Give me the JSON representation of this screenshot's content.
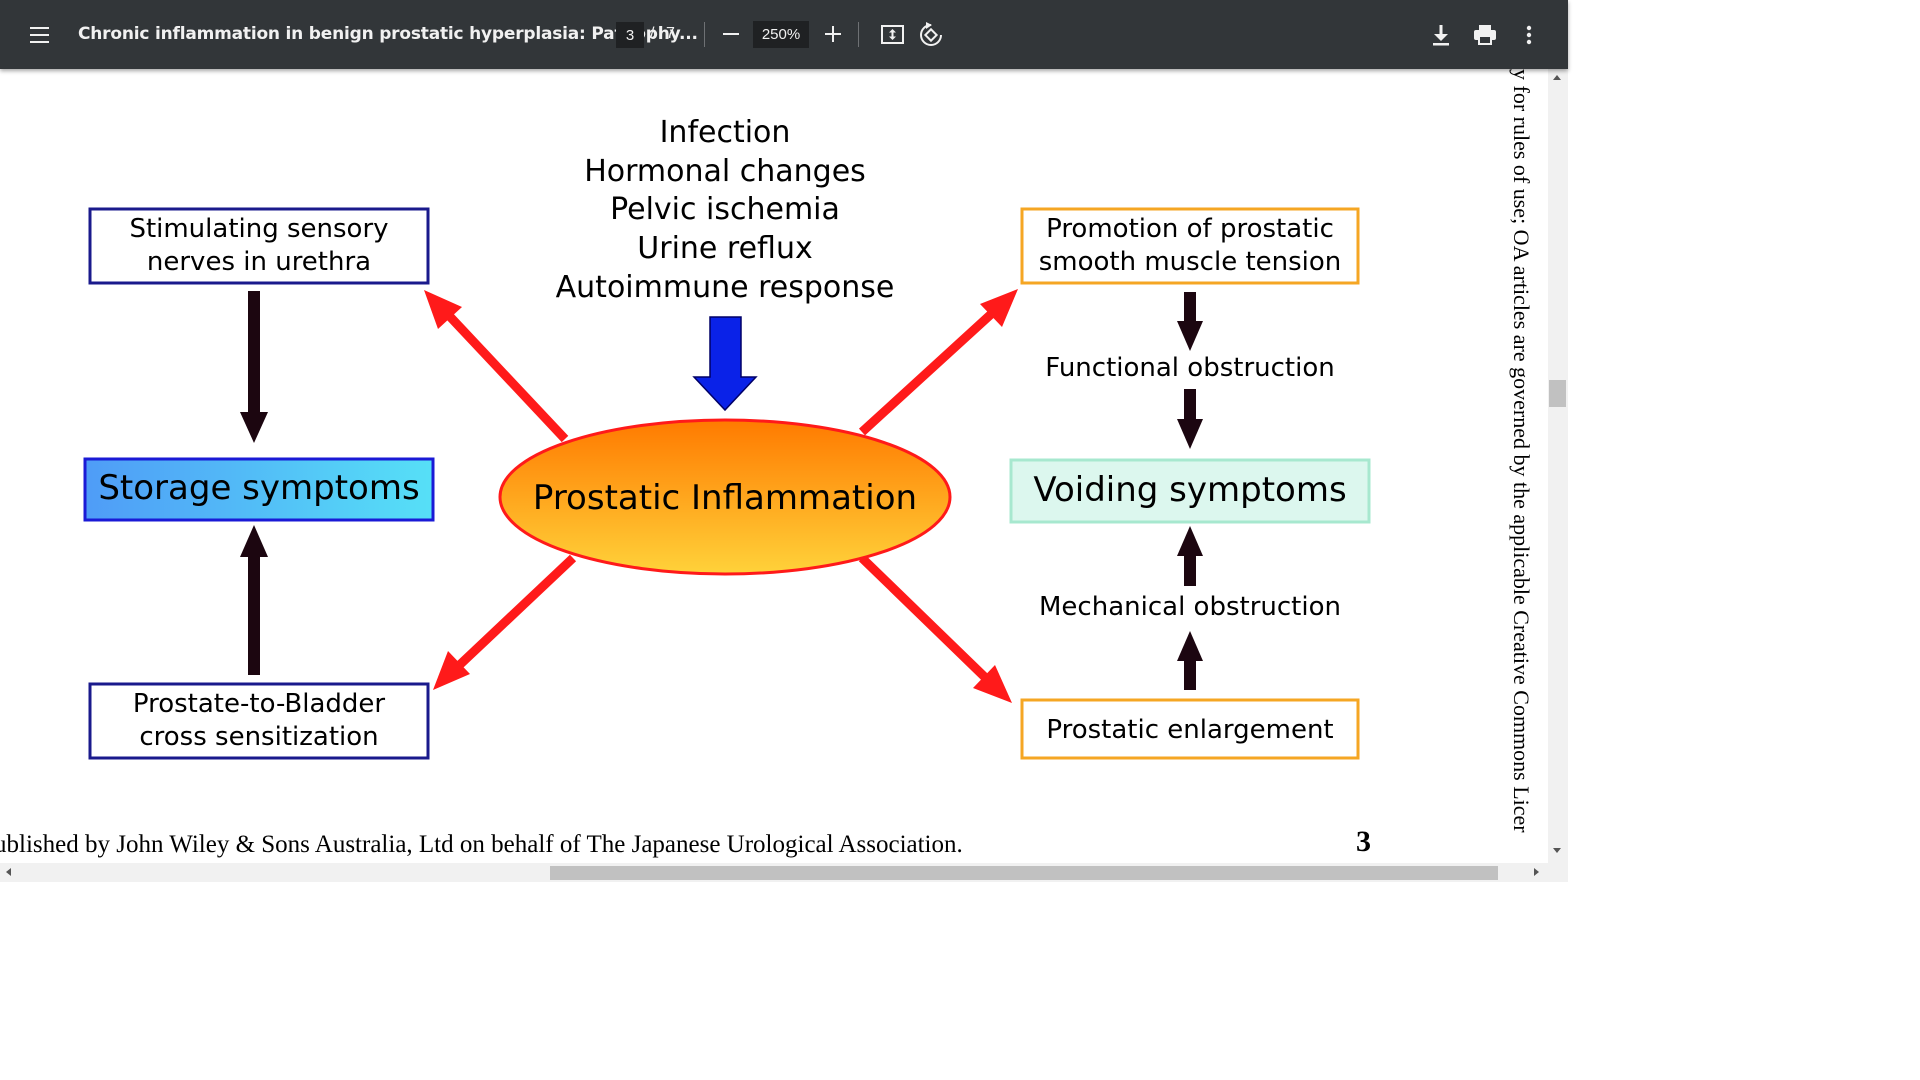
{
  "toolbar": {
    "title": "Chronic inflammation in benign prostatic hyperplasia: Pathophy...",
    "current_page": "3",
    "page_separator": "/",
    "total_pages": "7",
    "zoom": "250%"
  },
  "icons": {
    "menu": "menu-icon",
    "zoom_out": "minus-icon",
    "zoom_in": "plus-icon",
    "fit": "fit-to-page-icon",
    "rotate": "rotate-icon",
    "download": "download-icon",
    "print": "printer-icon",
    "more": "more-vertical-icon"
  },
  "colors": {
    "toolbar_bg": "#323639",
    "navy_box_border": "#1a1a8c",
    "orange_box_border": "#f5a623",
    "storage_fill": "#5fc9f5",
    "voiding_fill": "#dcf7ee",
    "red_arrow": "#ff1a1a",
    "blue_arrow": "#0a22e8"
  },
  "figure": {
    "causes": [
      "Infection",
      "Hormonal changes",
      "Pelvic ischemia",
      "Urine reflux",
      "Autoimmune response"
    ],
    "center": "Prostatic Inflammation",
    "left_top": [
      "Stimulating sensory",
      "nerves in urethra"
    ],
    "left_middle": "Storage symptoms",
    "left_bottom": [
      "Prostate-to-Bladder",
      "cross sensitization"
    ],
    "right_top": [
      "Promotion of prostatic",
      "smooth muscle tension"
    ],
    "right_label_top": "Functional obstruction",
    "right_middle": "Voiding symptoms",
    "right_label_bottom": "Mechanical obstruction",
    "right_bottom": "Prostatic enlargement"
  },
  "page": {
    "footer": "ublished by John Wiley & Sons Australia, Ltd on behalf of The Japanese Urological Association.",
    "page_number": "3",
    "side_text": "y for rules of use; OA articles are governed by the applicable Creative Commons Licer"
  }
}
